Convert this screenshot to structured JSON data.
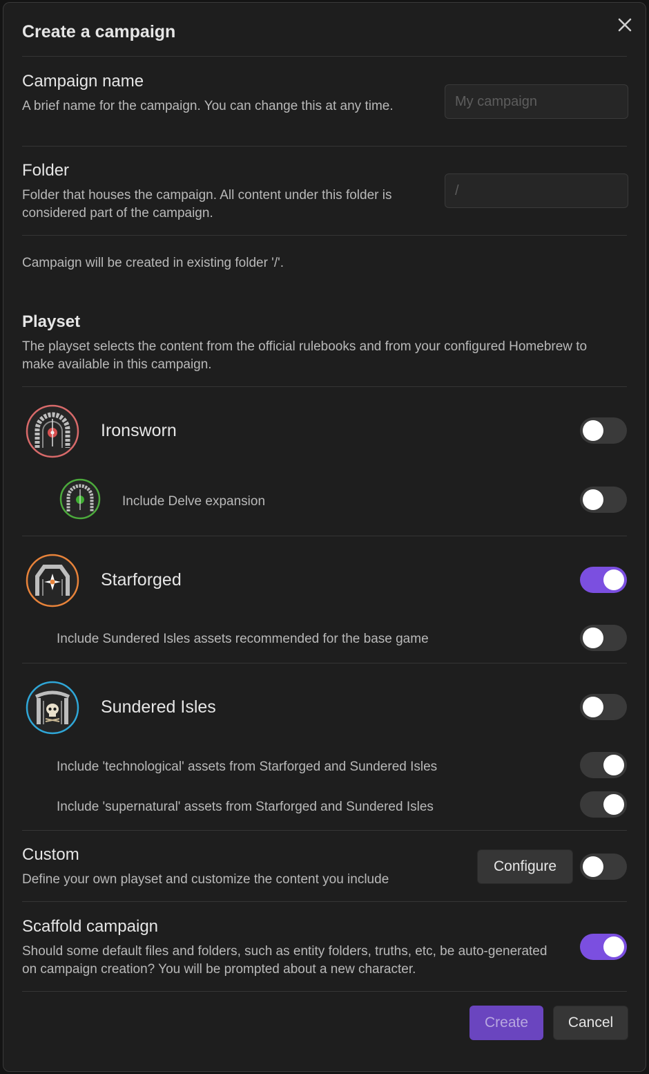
{
  "modal": {
    "title": "Create a campaign",
    "close_icon": "close-icon"
  },
  "campaign_name": {
    "label": "Campaign name",
    "description": "A brief name for the campaign. You can change this at any time.",
    "placeholder": "My campaign",
    "value": ""
  },
  "folder": {
    "label": "Folder",
    "description": "Folder that houses the campaign. All content under this folder is considered part of the campaign.",
    "placeholder": "/",
    "value": ""
  },
  "folder_notice": "Campaign will be created in existing folder '/'.",
  "playset": {
    "heading": "Playset",
    "description": "The playset selects the content from the official rulebooks and from your configured Homebrew to make available in this campaign."
  },
  "rulesets": {
    "ironsworn": {
      "label": "Ironsworn",
      "enabled": false,
      "icon": "ironsworn-logo-icon"
    },
    "delve": {
      "label": "Include Delve expansion",
      "enabled": false,
      "icon": "delve-logo-icon"
    },
    "starforged": {
      "label": "Starforged",
      "enabled": true,
      "icon": "starforged-logo-icon"
    },
    "sundered_recommended": {
      "label": "Include Sundered Isles assets recommended for the base game",
      "enabled": false
    },
    "sundered_isles": {
      "label": "Sundered Isles",
      "enabled": false,
      "icon": "sundered-isles-logo-icon"
    },
    "technological": {
      "label": "Include 'technological' assets from Starforged and Sundered Isles",
      "enabled": true
    },
    "supernatural": {
      "label": "Include 'supernatural' assets from Starforged and Sundered Isles",
      "enabled": true
    }
  },
  "custom": {
    "label": "Custom",
    "description": "Define your own playset and customize the content you include",
    "configure_label": "Configure",
    "enabled": false
  },
  "scaffold": {
    "label": "Scaffold campaign",
    "description": "Should some default files and folders, such as entity folders, truths, etc, be auto-generated on campaign creation? You will be prompted about a new character.",
    "enabled": true
  },
  "footer": {
    "create_label": "Create",
    "cancel_label": "Cancel"
  },
  "colors": {
    "accent": "#7b4fe0",
    "toggle_off": "#3a3a3a",
    "toggle_on_disabled": "#3a3a3a",
    "background": "#1e1e1e"
  }
}
